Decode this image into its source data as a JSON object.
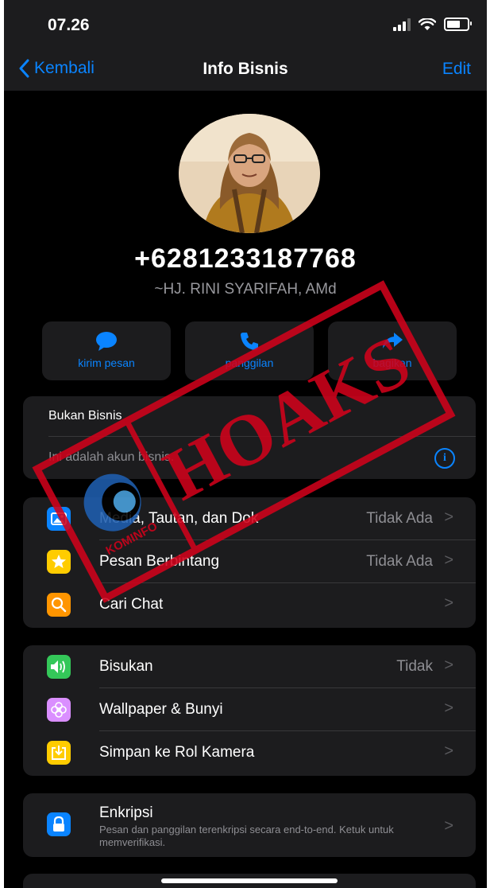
{
  "status": {
    "time": "07.26"
  },
  "nav": {
    "back": "Kembali",
    "title": "Info Bisnis",
    "edit": "Edit"
  },
  "profile": {
    "phone": "+6281233187768",
    "name": "~HJ. RINI SYARIFAH, AMd"
  },
  "actions": [
    {
      "label": "kirim pesan",
      "icon": "chat-bubble-icon"
    },
    {
      "label": "panggilan",
      "icon": "phone-icon"
    },
    {
      "label": "bagikan",
      "icon": "share-arrow-icon"
    }
  ],
  "business": {
    "title": "Bukan Bisnis",
    "description": "Ini adalah akun bisnis."
  },
  "group1": [
    {
      "label": "Media, Tautan, dan Dok",
      "value": "Tidak Ada",
      "icon": "photo-icon",
      "color": "#0a84ff"
    },
    {
      "label": "Pesan Berbintang",
      "value": "Tidak Ada",
      "icon": "star-icon",
      "color": "#ffcc00"
    },
    {
      "label": "Cari Chat",
      "value": "",
      "icon": "search-icon",
      "color": "#ff9500"
    }
  ],
  "group2": [
    {
      "label": "Bisukan",
      "value": "Tidak",
      "icon": "speaker-icon",
      "color": "#34c759"
    },
    {
      "label": "Wallpaper & Bunyi",
      "value": "",
      "icon": "flower-icon",
      "color": "#da8fff"
    },
    {
      "label": "Simpan ke Rol Kamera",
      "value": "",
      "icon": "save-icon",
      "color": "#ffcc00"
    }
  ],
  "encryption": {
    "title": "Enkripsi",
    "description": "Pesan dan panggilan terenkripsi secara end-to-end. Ketuk untuk memverifikasi.",
    "icon": "lock-icon",
    "color": "#0a84ff"
  },
  "stamp": {
    "text": "HOAKS",
    "logo_text": "KOMINFO",
    "color": "#d0021b"
  }
}
